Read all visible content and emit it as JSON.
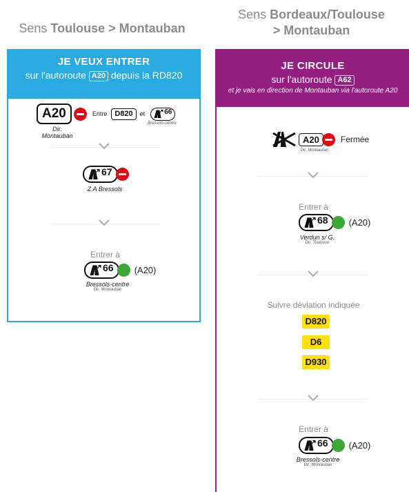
{
  "left": {
    "title_prefix": "Sens ",
    "title_bold": "Toulouse > Montauban",
    "header": {
      "title": "JE VEUX ENTRER",
      "line_before": "sur l'autoroute",
      "road": "A20",
      "line_after": "depuis la RD820"
    },
    "step1": {
      "road": "A20",
      "dir": "Dir. Montauban",
      "between": "Entre",
      "road2": "D820",
      "and": "et",
      "exit": "66",
      "exit_place": "Bressols-centre"
    },
    "step2": {
      "exit": "67",
      "place": "Z.A Bressols"
    },
    "step3": {
      "enter": "Entrer à",
      "exit": "66",
      "road": "(A20)",
      "place": "Bressols-centre",
      "dir": "Dir. Montauban"
    }
  },
  "right": {
    "title_prefix": "Sens ",
    "title_bold_1": "Bordeaux/Toulouse",
    "title_bold_2": "> Montauban",
    "header": {
      "title": "JE CIRCULE",
      "line_before": "sur l'autoroute",
      "road": "A62",
      "note": "et je vais en direction de Montauban via l'autoroute A20"
    },
    "step1": {
      "road": "A20",
      "status": "Fermée",
      "dir": "Dir. Montauban"
    },
    "step2": {
      "enter": "Entrer à",
      "exit": "68",
      "road": "(A20)",
      "place": "Verdun s/ G.",
      "dir": "Dir. Toulouse"
    },
    "step3": {
      "text": "Suivre déviation indiquée",
      "roads": [
        "D820",
        "D6",
        "D930"
      ]
    },
    "step4": {
      "enter": "Entrer à",
      "exit": "66",
      "road": "(A20)",
      "place": "Bressols-centre",
      "dir": "Dir. Montauban"
    }
  },
  "colors": {
    "blue": "#29abe2",
    "purple": "#951e81",
    "red": "#e30613",
    "green": "#3aaa35",
    "yellow": "#ffe000"
  }
}
